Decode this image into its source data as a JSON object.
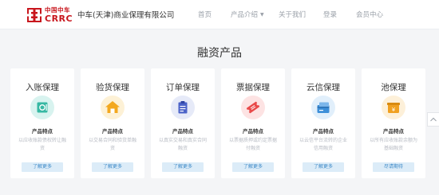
{
  "header": {
    "logo_cn": "中国中车",
    "logo_en": "CRRC",
    "company_name": "中车(天津)商业保理有限公司",
    "brand_color": "#c8161d"
  },
  "nav": {
    "items": [
      {
        "label": "首页",
        "icon": ""
      },
      {
        "label": "产品介绍",
        "icon": "chevron-down-icon"
      },
      {
        "label": "关于我们",
        "icon": ""
      },
      {
        "label": "登录",
        "icon": ""
      },
      {
        "label": "会员中心",
        "icon": ""
      }
    ]
  },
  "main": {
    "title": "融资产品",
    "products": [
      {
        "name": "入账保理",
        "feature_label": "产品特点",
        "desc": "以应收账款债权转让融资",
        "button": "了解更多",
        "icon": "safe-icon",
        "icon_bg": "#d8f3ef",
        "icon_color": "#37b8a3"
      },
      {
        "name": "验货保理",
        "feature_label": "产品特点",
        "desc": "以交易合同和验货单融资",
        "button": "了解更多",
        "icon": "house-icon",
        "icon_bg": "#fdf1d6",
        "icon_color": "#f3a81f"
      },
      {
        "name": "订单保理",
        "feature_label": "产品特点",
        "desc": "以真实交易和真实合同融资",
        "button": "了解更多",
        "icon": "clipboard-icon",
        "icon_bg": "#e6eaf8",
        "icon_color": "#4b63c8"
      },
      {
        "name": "票据保理",
        "feature_label": "产品特点",
        "desc": "以票据质押或约定票据付融资",
        "button": "了解更多",
        "icon": "ticket-icon",
        "icon_bg": "#fde3e3",
        "icon_color": "#e94a4a"
      },
      {
        "name": "云信保理",
        "feature_label": "产品特点",
        "desc": "以云信平台流转的企业信用融资",
        "button": "了解更多",
        "icon": "cloud-card-icon",
        "icon_bg": "#e1effb",
        "icon_color": "#3d8fd8"
      },
      {
        "name": "池保理",
        "feature_label": "产品特点",
        "desc": "以所有应收账款余额为基础融资",
        "button": "尽请期待",
        "icon": "coin-box-icon",
        "icon_bg": "#fdf0d9",
        "icon_color": "#f0a020"
      }
    ]
  }
}
